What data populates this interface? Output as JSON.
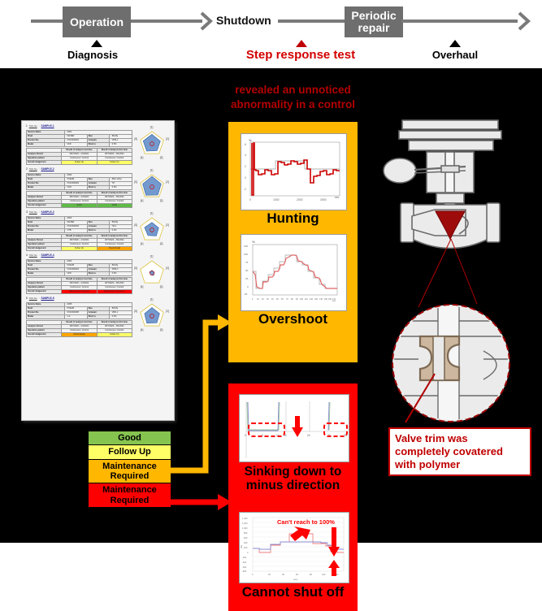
{
  "timeline": {
    "stages": [
      {
        "label": "Operation",
        "type": "box"
      },
      {
        "label": "Shutdown",
        "type": "plain"
      },
      {
        "label": "Periodic\nrepair",
        "label_line1": "Periodic",
        "label_line2": "repair",
        "type": "box"
      }
    ],
    "markers": [
      {
        "label": "Diagnosis",
        "color": "#000000"
      },
      {
        "label": "Step response test",
        "color": "#d30000"
      },
      {
        "label": "Overhaul",
        "color": "#000000"
      }
    ]
  },
  "headline": {
    "line1": "revealed an unnoticed",
    "line2": "abnormality in a control"
  },
  "report": {
    "entries": [
      {
        "no": "1",
        "tag_label": "TAG No",
        "tag_value": "SAMPLE-1",
        "service_label": "Service Name",
        "service_value": "A001",
        "fluid_label": "Fluid",
        "fluid_value": "WATER",
        "size_label": "Size",
        "size_value": "80(3A)",
        "product_label": "Product No",
        "product_value": "XX10000001",
        "actuator_label": "Actuator",
        "actuator_value": "VPM-1",
        "model_label": "Model",
        "model_value": "VFR",
        "shutlv_label": "Shut Lv",
        "shutlv_value": "0.5%",
        "col_last": "Result of analysis last time",
        "col_this": "Result of analysis this time",
        "row_period_label": "Analysis Period",
        "row_period_last": "28/7/2020 ~ 4/1/2021",
        "row_period_this": "28/7/2020 ~ 8/1/2021",
        "row_pattern_label": "Operation pattern",
        "row_pattern_last": "Continuous / Control",
        "row_pattern_this": "Continuous / Control",
        "row_judge_label": "Overall Judgement",
        "judge_last": "Follow Up",
        "judge_this": "Follow Up",
        "judge_last_color": "follow",
        "judge_this_color": "follow"
      },
      {
        "no": "2",
        "tag_label": "TAG No",
        "tag_value": "SAMPLE-2",
        "service_label": "Service Name",
        "service_value": "A002",
        "fluid_label": "Fluid",
        "fluid_value": "STEAM",
        "size_label": "Size",
        "size_value": "65(2 1/2A)",
        "product_label": "Product No",
        "product_value": "XX10000002",
        "actuator_label": "Actuator",
        "actuator_value": "7R",
        "model_label": "Model",
        "model_value": "VCR",
        "shutlv_label": "Shut Lv",
        "shutlv_value": "0.5%",
        "col_last": "Result of analysis last time",
        "col_this": "Result of analysis this time",
        "row_period_label": "Analysis Period",
        "row_period_last": "28/7/2020 ~ 4/1/2021",
        "row_period_this": "28/7/2020 ~ 8/1/2021",
        "row_pattern_label": "Operation pattern",
        "row_pattern_last": "Continuous / Control",
        "row_pattern_this": "Continuous / Control",
        "row_judge_label": "Overall Judgement",
        "judge_last": "Good",
        "judge_this": "Good",
        "judge_last_color": "good",
        "judge_this_color": "good"
      },
      {
        "no": "3",
        "tag_label": "TAG No",
        "tag_value": "SAMPLE-3",
        "service_label": "Service Name",
        "service_value": "A003",
        "fluid_label": "Fluid",
        "fluid_value": "WATER",
        "size_label": "Size",
        "size_value": "80(3A)",
        "product_label": "Product No",
        "product_value": "XX10000003",
        "actuator_label": "Actuator",
        "actuator_value": "HA-1",
        "model_label": "Model",
        "model_value": "VTB",
        "shutlv_label": "Shut Lv",
        "shutlv_value": "0.3%",
        "col_last": "Result of analysis last time",
        "col_this": "Result of analysis this time",
        "row_period_label": "Analysis Period",
        "row_period_last": "28/7/2020 ~ 4/1/2021",
        "row_period_this": "28/7/2020 ~ 8/1/2021",
        "row_pattern_label": "Operation pattern",
        "row_pattern_last": "Continuous / Control",
        "row_pattern_this": "Continuous / Control",
        "row_judge_label": "Overall Judgement",
        "judge_last": "Follow Up",
        "judge_this": "Check Detail",
        "judge_last_color": "follow",
        "judge_this_color": "maint"
      },
      {
        "no": "4",
        "tag_label": "TAG No",
        "tag_value": "SAMPLE-4",
        "service_label": "Service Name",
        "service_value": "A004",
        "fluid_label": "Fluid",
        "fluid_value": "STEAM",
        "size_label": "Size",
        "size_value": "80(3A)",
        "product_label": "Product No",
        "product_value": "XX10000004",
        "actuator_label": "Actuator",
        "actuator_value": "PSM-3",
        "model_label": "Model",
        "model_value": "VFR",
        "shutlv_label": "Shut Lv",
        "shutlv_value": "0.5%",
        "col_last": "Result of analysis last time",
        "col_this": "Result of analysis this time",
        "row_period_label": "Analysis Period",
        "row_period_last": "28/7/2020 ~ 4/1/2021",
        "row_period_this": "28/7/2020 ~ 8/1/2021",
        "row_pattern_label": "Operation pattern",
        "row_pattern_last": "Continuous / Control",
        "row_pattern_this": "Continuous / Control",
        "row_judge_label": "Overall Judgement",
        "judge_last": "Maintenance Required",
        "judge_this": "Maintenance Required",
        "judge_last_color": "crit",
        "judge_this_color": "crit"
      },
      {
        "no": "5",
        "tag_label": "TAG No",
        "tag_value": "SAMPLE-5",
        "service_label": "Service Name",
        "service_value": "A005",
        "fluid_label": "Fluid",
        "fluid_value": "STEAM",
        "size_label": "Size",
        "size_value": "80(3A)",
        "product_label": "Product No",
        "product_value": "XX10000005",
        "actuator_label": "Actuator",
        "actuator_value": "VRD-1",
        "model_label": "Model",
        "model_value": "V-4",
        "shutlv_label": "Shut Lv",
        "shutlv_value": "0.3%",
        "col_last": "Result of analysis last time",
        "col_this": "Result of analysis this time",
        "row_period_label": "Analysis Period",
        "row_period_last": "28/7/2020 ~ 4/1/2021",
        "row_period_this": "28/7/2020 ~ 8/1/2021",
        "row_pattern_label": "Operation pattern",
        "row_pattern_last": "Continuous / Control",
        "row_pattern_this": "Continuous / Control",
        "row_judge_label": "Overall Judgement",
        "judge_last": "Check Detail",
        "judge_this": "Follow Up",
        "judge_last_color": "maint",
        "judge_this_color": "follow"
      }
    ],
    "radar_axis_labels": [
      "[1]",
      "[2]",
      "[3]",
      "[4]",
      "[5]"
    ]
  },
  "legend": {
    "rows": [
      {
        "label": "Good",
        "color": "#85c44f"
      },
      {
        "label": "Follow Up",
        "color": "#ffff66"
      },
      {
        "label": "Maintenance Required",
        "line1": "Maintenance",
        "line2": "Required",
        "color": "#ffb700"
      },
      {
        "label": "Maintenance Required",
        "line1": "Maintenance",
        "line2": "Required",
        "color": "#ff0000"
      }
    ]
  },
  "panels": {
    "yellow": {
      "color": "#ffb700",
      "charts": [
        {
          "caption": "Hunting"
        },
        {
          "caption": "Overshoot"
        }
      ]
    },
    "red": {
      "color": "#ff0000",
      "charts": [
        {
          "caption_line1": "Sinking down to",
          "caption_line2": "minus direction"
        },
        {
          "caption_line1": "Cannot shut off",
          "caption_line2": "",
          "annotation": "Can't reach to 100%"
        }
      ]
    }
  },
  "chart_data": [
    {
      "type": "line",
      "title": "Hunting",
      "xlabel": "sec",
      "ylabel": "%",
      "xlim": [
        0,
        4000
      ],
      "ylim": [
        -2,
        6
      ],
      "xticks": [
        "0",
        "1000",
        "2000",
        "3000"
      ],
      "yticks": [
        "6",
        "4",
        "2",
        "0",
        "-2"
      ],
      "series": [
        {
          "name": "Measured",
          "color": "#cc0000",
          "x": [
            0,
            60,
            120,
            180,
            240,
            300,
            360,
            420,
            480,
            540,
            600,
            660,
            720,
            780,
            840,
            900,
            960,
            1020,
            1080,
            1140,
            1200,
            1260,
            1320,
            1380,
            1440,
            1500,
            1560,
            1620,
            1680,
            1740,
            1800,
            1860,
            1920,
            1980,
            2040,
            2100,
            2160,
            2220,
            2280,
            2340,
            2400,
            2460,
            2520,
            2580,
            2640,
            2700,
            2760,
            2820,
            2880,
            2940,
            3000,
            3060,
            3120,
            3180,
            3240,
            3300,
            3360,
            3420,
            3480,
            3540,
            3600,
            3700,
            3800,
            3900
          ],
          "y": [
            6,
            -2,
            2.1,
            2.0,
            1.4,
            1.4,
            2.2,
            2.1,
            1.4,
            1.4,
            2.2,
            2.1,
            1.4,
            1.4,
            2.2,
            2.1,
            3.4,
            3.3,
            2.8,
            2.8,
            3.6,
            3.5,
            2.9,
            2.9,
            3.7,
            3.6,
            3.0,
            3.0,
            3.7,
            3.6,
            3.0,
            3.0,
            3.8,
            3.7,
            3.1,
            3.1,
            3.8,
            3.7,
            2.0,
            0.2,
            0.2,
            1.2,
            1.3,
            1.4,
            1.3,
            2.1,
            2.0,
            1.4,
            1.4,
            2.2,
            2.1,
            1.4,
            1.4,
            2.2,
            2.1,
            1.4,
            1.4,
            2.2,
            2.1,
            1.5,
            2.2,
            2.1,
            2.2,
            2.1
          ]
        },
        {
          "name": "Setpoint",
          "color": "#9a9a9a",
          "x": [
            0,
            950,
            950,
            2280,
            2280,
            4000
          ],
          "y": [
            2.0,
            2.0,
            3.3,
            3.3,
            2.0,
            2.0
          ]
        }
      ]
    },
    {
      "type": "line",
      "title": "Overshoot",
      "xlabel": "sec",
      "ylabel": "%",
      "xlim": [
        0,
        180
      ],
      "ylim": [
        -25,
        125
      ],
      "xticks": [
        "0",
        "10",
        "20",
        "30",
        "40",
        "50",
        "60",
        "70",
        "80",
        "90",
        "100",
        "110",
        "120",
        "130",
        "140",
        "150",
        "160",
        "170",
        "180"
      ],
      "yticks": [
        "125",
        "100",
        "75",
        "50",
        "25",
        "0",
        "-25"
      ],
      "series": [
        {
          "name": "Measured",
          "color": "#e06666",
          "x": [
            0,
            4,
            8,
            12,
            16,
            20,
            26,
            32,
            38,
            44,
            50,
            56,
            62,
            68,
            74,
            80,
            86,
            92,
            98,
            104,
            110,
            116,
            122,
            128,
            134,
            140,
            146,
            152,
            158,
            164,
            170,
            176,
            180
          ],
          "y": [
            50,
            38,
            6,
            4,
            4,
            22,
            20,
            30,
            42,
            40,
            55,
            62,
            60,
            72,
            82,
            80,
            100,
            104,
            100,
            86,
            72,
            70,
            60,
            58,
            50,
            36,
            34,
            22,
            6,
            4,
            4,
            4,
            4
          ]
        },
        {
          "name": "Setpoint",
          "color": "#a6a6a6",
          "x": [
            0,
            6,
            6,
            18,
            18,
            30,
            30,
            42,
            42,
            54,
            54,
            66,
            66,
            78,
            78,
            90,
            90,
            102,
            102,
            114,
            114,
            126,
            126,
            138,
            138,
            150,
            150,
            162,
            162,
            180
          ],
          "y": [
            50,
            50,
            4,
            4,
            22,
            22,
            40,
            40,
            60,
            60,
            80,
            80,
            100,
            100,
            100,
            100,
            80,
            80,
            70,
            70,
            58,
            58,
            40,
            40,
            22,
            22,
            4,
            4,
            4,
            4
          ]
        }
      ]
    },
    {
      "type": "line",
      "title": "Sinking down to minus direction",
      "xlabel": "",
      "ylabel": "",
      "xlim": [
        0,
        30
      ],
      "ylim": [
        -5,
        100
      ],
      "xticks": [
        "0",
        "5",
        "10",
        "15",
        "20",
        "25",
        "30"
      ],
      "yticks": [],
      "annotations": [
        {
          "text": "",
          "shape": "dashed-rect-left"
        },
        {
          "text": "",
          "shape": "dashed-rect-right"
        },
        {
          "text": "",
          "shape": "down-arrow"
        }
      ],
      "series": [
        {
          "name": "Measured",
          "color": "#8a8ad0",
          "x": [
            0,
            0.4,
            1,
            5,
            9,
            9.6,
            10,
            10.4,
            20,
            24,
            24.4,
            25,
            26,
            30
          ],
          "y": [
            96,
            4,
            -1.5,
            -1.8,
            -1.8,
            2,
            96,
            96,
            96,
            96,
            4,
            -1.5,
            -1.0,
            -1.0
          ]
        },
        {
          "name": "Setpoint",
          "color": "#9ccc9c",
          "x": [
            0,
            0.6,
            1,
            9.4,
            10,
            10.6,
            24,
            24.6,
            25,
            30
          ],
          "y": [
            96,
            2,
            0,
            0,
            96,
            96,
            96,
            2,
            0,
            0
          ]
        }
      ]
    },
    {
      "type": "line",
      "title": "Cannot shut off",
      "xlabel": "sec",
      "ylabel": "(%)",
      "xlim": [
        0,
        180
      ],
      "ylim": [
        -1000,
        1400
      ],
      "xticks": [
        "0",
        "20",
        "40",
        "60",
        "80",
        "100",
        "120",
        "140",
        "160",
        "180"
      ],
      "yticks": [
        "1400",
        "1200",
        "1000",
        "800",
        "600",
        "400",
        "200",
        "0",
        "-200",
        "-400",
        "-600",
        "-800"
      ],
      "annotations": [
        {
          "text": "Can't reach to 100%",
          "color": "#ff0000"
        }
      ],
      "series": [
        {
          "name": "Input",
          "color": "#f08080",
          "x": [
            0,
            8,
            8,
            26,
            26,
            44,
            44,
            62,
            62,
            80,
            80,
            110,
            110,
            140,
            140,
            152,
            152,
            165,
            165,
            180
          ],
          "y": [
            180,
            180,
            60,
            60,
            280,
            280,
            440,
            440,
            820,
            820,
            820,
            820,
            520,
            520,
            380,
            380,
            80,
            80,
            60,
            60
          ]
        },
        {
          "name": "Travel",
          "color": "#8a8ad0",
          "x": [
            0,
            8,
            8,
            26,
            26,
            44,
            44,
            70,
            70,
            110,
            110,
            140,
            140,
            152,
            152,
            165,
            165,
            180
          ],
          "y": [
            180,
            180,
            160,
            160,
            300,
            300,
            420,
            420,
            420,
            420,
            400,
            400,
            320,
            320,
            200,
            200,
            180,
            180
          ]
        }
      ]
    }
  ],
  "valve": {
    "diagram_name": "control-valve-cutaway",
    "callout": {
      "line1": "Valve trim was",
      "line2": "completely covatered",
      "line3": "with polymer"
    }
  },
  "colors": {
    "red": "#ff0000",
    "dark_red": "#c00000",
    "amber": "#ffb700",
    "yellow": "#ffff66",
    "green": "#85c44f",
    "gray_box": "#6e6e6e",
    "black": "#000000"
  }
}
